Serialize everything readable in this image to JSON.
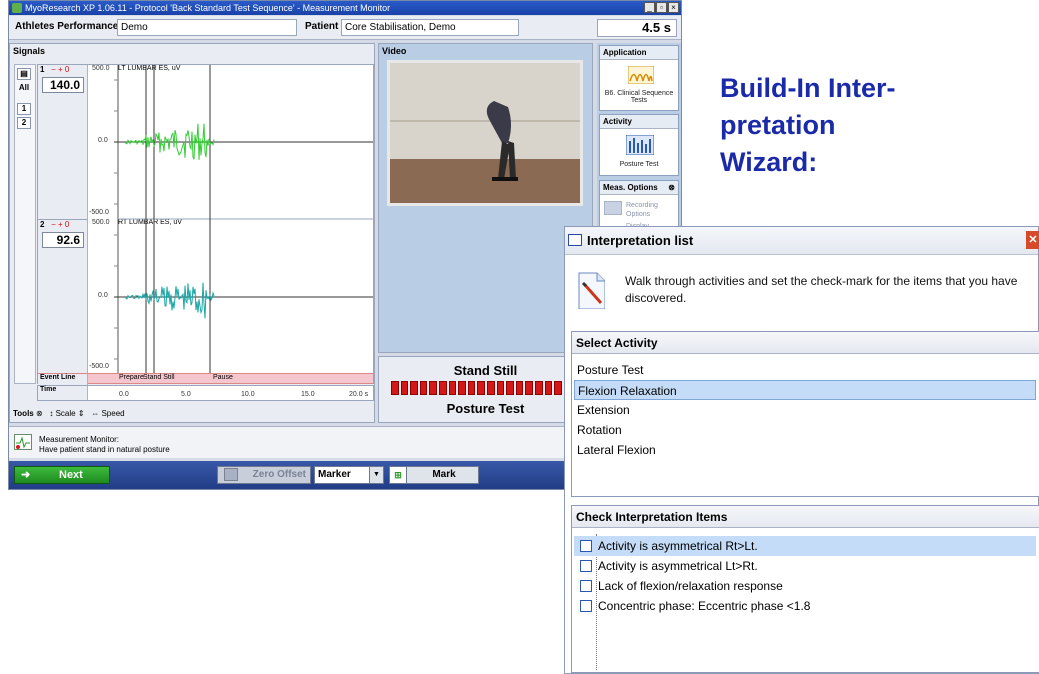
{
  "window": {
    "title": "MyoResearch XP 1.06.11 - Protocol 'Back Standard Test Sequence' - Measurement Monitor",
    "controls": [
      "_",
      "×"
    ]
  },
  "header": {
    "athletes_label": "Athletes Performance",
    "athletes_value": "Demo",
    "patient_label": "Patient",
    "patient_value": "Core Stabilisation, Demo",
    "timer": "4.5 s"
  },
  "signals": {
    "title": "Signals",
    "tools": [
      "All",
      "1",
      "2"
    ],
    "channels": [
      {
        "index": "1",
        "marks": "− + 0",
        "value": "140.0",
        "name": "LT LUMBAR ES, uV",
        "top": "500.0",
        "mid": "0.0",
        "bottom": "-500.0"
      },
      {
        "index": "2",
        "marks": "− + 0",
        "value": "92.6",
        "name": "RT LUMBAR ES, uV",
        "top": "500.0",
        "mid": "0.0",
        "bottom": "-500.0"
      }
    ],
    "event_line_label": "Event Line",
    "events": [
      "Prepare",
      "Stand Still",
      "Pause"
    ],
    "time_label": "Time",
    "time_ticks": [
      "0.0",
      "5.0",
      "10.0",
      "15.0",
      "20.0 s"
    ],
    "footer": {
      "tools": "Tools",
      "scale": "Scale",
      "speed": "Speed"
    }
  },
  "video": {
    "title": "Video"
  },
  "status": {
    "activity": "Stand Still",
    "test": "Posture Test"
  },
  "side": {
    "application_head": "Application",
    "application_caption": "B6. Clinical Sequence Tests",
    "activity_head": "Activity",
    "activity_caption": "Posture Test",
    "meas_head": "Meas. Options",
    "recording_label": "Recording Options",
    "display_label": "Display"
  },
  "instruction": {
    "line1": "Measurement Monitor:",
    "line2": "Have patient stand in natural posture"
  },
  "bottom": {
    "next": "Next",
    "zero_offset": "Zero Offset",
    "marker": "Marker",
    "mark": "Mark"
  },
  "heading": {
    "line1": "Build-In Inter-",
    "line2": "pretation",
    "line3": "Wizard:"
  },
  "dialog": {
    "title": "Interpretation list",
    "description": "Walk through activities and set the check-mark for the items that you have discovered.",
    "select_activity_head": "Select Activity",
    "activities": [
      "Posture Test",
      "Flexion Relaxation",
      "Extension",
      "Rotation",
      "Lateral Flexion"
    ],
    "selected_activity": "Flexion Relaxation",
    "check_items_head": "Check Interpretation Items",
    "items": [
      "Activity is asymmetrical Rt>Lt.",
      "Activity is asymmetrical Lt>Rt.",
      "Lack of flexion/relaxation response",
      "Concentric phase: Eccentric phase <1.8"
    ]
  },
  "colors": {
    "heading": "#1a2aa8",
    "signal_ch1": "#33cc33",
    "signal_ch2": "#1aa6a6",
    "status_bar": "#d41818"
  }
}
